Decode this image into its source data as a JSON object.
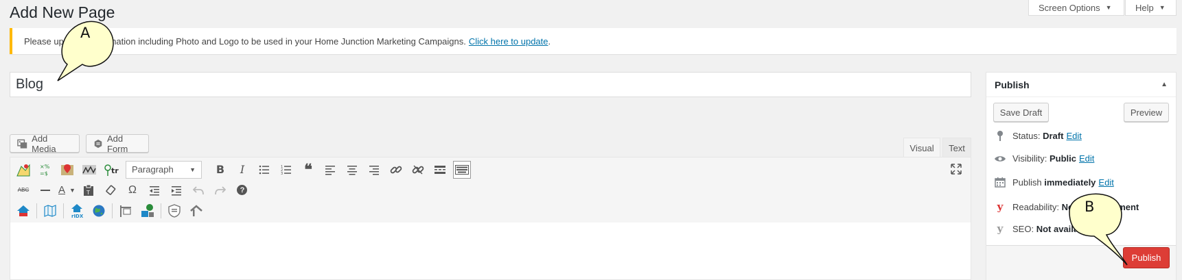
{
  "header": {
    "title": "Add New Page",
    "screen_options": "Screen Options",
    "help": "Help"
  },
  "notice": {
    "text": "Please upd            formation including Photo and Logo to be used in your Home Junction Marketing Campaigns.",
    "link": "Click here to update",
    "suffix": "."
  },
  "title_field": {
    "value": "Blog"
  },
  "media_buttons": {
    "add_media": "Add Media",
    "add_form": "Add Form"
  },
  "editor_tabs": {
    "visual": "Visual",
    "text": "Text"
  },
  "toolbar": {
    "format_select": "Paragraph",
    "text_color_glyph": "A",
    "strike_glyph": "ABC",
    "omega_glyph": "Ω",
    "help_glyph": "?"
  },
  "publish": {
    "title": "Publish",
    "save_draft": "Save Draft",
    "preview": "Preview",
    "status_label": "Status:",
    "status_value": "Draft",
    "visibility_label": "Visibility:",
    "visibility_value": "Public",
    "publish_label": "Publish",
    "publish_value": "immediately",
    "edit": "Edit",
    "readability_label": "Readability:",
    "readability_value": "Ne                  ment",
    "seo_label": "SEO:",
    "seo_value": "Not availa",
    "publish_button": "Publish"
  },
  "callouts": {
    "a": "A",
    "b": "B"
  },
  "colors": {
    "accent_link": "#0073aa",
    "notice_border": "#ffb900",
    "publish_button": "#dd3d36",
    "yoast_red": "#dc3232"
  }
}
